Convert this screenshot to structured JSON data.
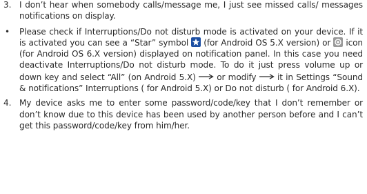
{
  "faq": {
    "item3": {
      "number": "3.",
      "question": "I don’t hear when somebody calls/message me, I just see missed calls/ messages notifications on display."
    },
    "answer3": {
      "bullet": "•",
      "part1": "Please check if Interruptions/Do not disturb mode is activated on your device. If it is activated you can see a “Star” symbol",
      "part2": "(for Android OS 5.X version) or",
      "part3": "icon (for Android OS 6.X version) displayed on notification panel. In this case you need deactivate Interruptions/Do not disturb mode. To do it just press volume  up or down key and select “All” (on Android 5.X)",
      "part4": "or modify",
      "part5": "it in Settings “Sound & notifications” Interruptions ( for Android 5.X) or Do not disturb ( for Android 6.X)."
    },
    "item4": {
      "number": "4.",
      "question": "My device asks me to enter some password/code/key that I don’t remember or don’t know due to this device has been used by another person before and I can’t get this password/code/key from him/her."
    }
  },
  "icons": {
    "star": "star-icon",
    "circle": "circle-icon",
    "arrow": "right-arrow-icon",
    "star_bg": "#1d4fa3",
    "circle_bg": "#9a9a9a"
  }
}
